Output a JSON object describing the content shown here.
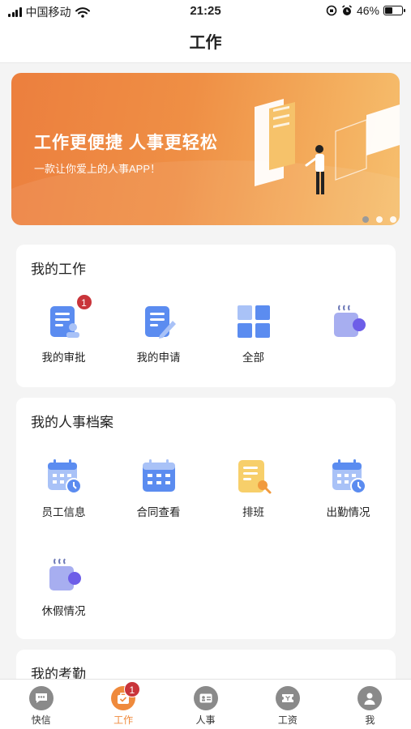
{
  "status_bar": {
    "carrier": "中国移动",
    "time": "21:25",
    "battery": "46%",
    "battery_level": 0.46
  },
  "navbar": {
    "title": "工作"
  },
  "banner": {
    "headline": "工作更便捷 人事更轻松",
    "subline": "一款让你爱上的人事APP！"
  },
  "my_work": {
    "title": "我的工作",
    "items": [
      {
        "label": "我的审批",
        "icon": "approval-doc-icon",
        "badge": "1"
      },
      {
        "label": "我的申请",
        "icon": "application-edit-icon"
      },
      {
        "label": "全部",
        "icon": "all-grid-icon"
      },
      {
        "label": "",
        "icon": "coffee-cup-icon"
      }
    ]
  },
  "hr_files": {
    "title": "我的人事档案",
    "items": [
      {
        "label": "员工信息",
        "icon": "calendar-clock-icon"
      },
      {
        "label": "合同查看",
        "icon": "calendar-icon"
      },
      {
        "label": "排班",
        "icon": "schedule-doc-icon"
      },
      {
        "label": "出勤情况",
        "icon": "calendar-clock-icon"
      },
      {
        "label": "休假情况",
        "icon": "coffee-cup-icon"
      }
    ]
  },
  "attendance": {
    "title": "我的考勤"
  },
  "tabbar": {
    "items": [
      {
        "label": "快信",
        "icon": "chat-icon"
      },
      {
        "label": "工作",
        "icon": "work-bag-icon",
        "badge": "1",
        "active": true
      },
      {
        "label": "人事",
        "icon": "id-card-icon"
      },
      {
        "label": "工资",
        "icon": "ticket-icon"
      },
      {
        "label": "我",
        "icon": "person-icon"
      }
    ]
  },
  "colors": {
    "accent": "#ef8a3c",
    "icon_blue": "#5b8cf0",
    "icon_light_blue": "#a9c2f7",
    "badge_red": "#c9343a"
  }
}
